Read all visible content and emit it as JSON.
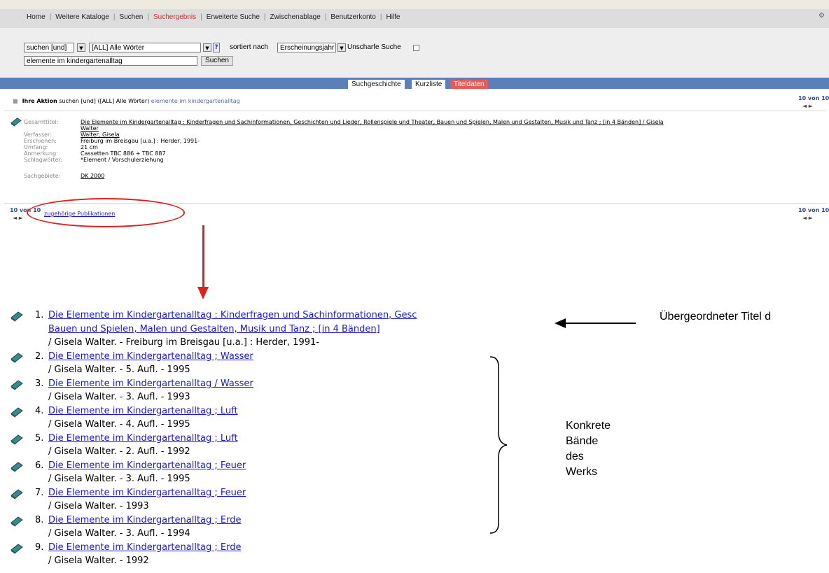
{
  "menu": {
    "items": [
      "Home",
      "Weitere Kataloge",
      "Suchen",
      "Suchergebnis",
      "Erweiterte Suche",
      "Zwischenablage",
      "Benutzerkonto",
      "Hilfe"
    ],
    "active_index": 3
  },
  "search": {
    "operator_value": "suchen [und]",
    "field_value": "[ALL] Alle Wörter",
    "help_symbol": "?",
    "sorted_by_label": "sortiert nach",
    "sort_value": "Erscheinungsjahr",
    "fuzzy_label": "Unscharfe Suche",
    "query_value": "elemente im kindergartenalltag",
    "submit_label": "Suchen"
  },
  "tabs": [
    "Suchgeschichte",
    "Kurzliste",
    "Titeldaten"
  ],
  "action": {
    "label": "Ihre Aktion",
    "text": "suchen [und] ([ALL] Alle Wörter)",
    "query": "elemente im kindergartenalltag"
  },
  "pager": {
    "text": "10 von 10",
    "arrows": "◄  ►"
  },
  "record": {
    "gesamttitel_label": "Gesamttitel:",
    "gesamttitel_line1": "Die Elemente im Kindergartenalltag : Kinderfragen und Sachinformationen, Geschichten und Lieder, Rollenspiele und Theater, Bauen und Spielen, Malen und Gestalten, Musik und Tanz ; [in 4 Bänden] / Gisela",
    "gesamttitel_line2": "Walter",
    "verfasser_label": "Verfasser:",
    "verfasser_value": "Walter, Gisela",
    "erschienen_label": "Erschienen:",
    "erschienen_value": "Freiburg im Breisgau [u.a.] : Herder, 1991-",
    "umfang_label": "Umfang:",
    "umfang_value": "21 cm",
    "anmerkung_label": "Anmerkung:",
    "anmerkung_value": "Cassetten TBC 886 + TBC 887",
    "schlagwoerter_label": "Schlagwörter:",
    "schlagwoerter_value": "*Element / Vorschulerziehung",
    "sachgebiete_label": "Sachgebiete:",
    "sachgebiete_value": "DK 2000"
  },
  "related_link": "zugehörige Publikationen",
  "list": [
    {
      "num": "1.",
      "title": "Die Elemente im Kindergartenalltag : Kinderfragen und Sachinformationen, Gesc",
      "title2": "Bauen und Spielen, Malen und Gestalten, Musik und Tanz ; [in 4 Bänden]",
      "sub": "/ Gisela Walter. - Freiburg im Breisgau [u.a.] : Herder, 1991-"
    },
    {
      "num": "2.",
      "title": "Die Elemente im Kindergartenalltag ; Wasser",
      "sub": "/ Gisela Walter. - 5. Aufl. - 1995"
    },
    {
      "num": "3.",
      "title": "Die Elemente im Kindergartenalltag / Wasser",
      "sub": "/ Gisela Walter. - 3. Aufl. - 1993"
    },
    {
      "num": "4.",
      "title": "Die Elemente im Kindergartenalltag ; Luft",
      "sub": "/ Gisela Walter. - 4. Aufl. - 1995"
    },
    {
      "num": "5.",
      "title": "Die Elemente im Kindergartenalltag ; Luft",
      "sub": "/ Gisela Walter. - 2. Aufl. - 1992"
    },
    {
      "num": "6.",
      "title": "Die Elemente im Kindergartenalltag ; Feuer",
      "sub": "/ Gisela Walter. - 3. Aufl. - 1995"
    },
    {
      "num": "7.",
      "title": "Die Elemente im Kindergartenalltag ; Feuer",
      "sub": "/ Gisela Walter. - 1993"
    },
    {
      "num": "8.",
      "title": "Die Elemente im Kindergartenalltag ; Erde",
      "sub": "/ Gisela Walter. - 3. Aufl. - 1994"
    },
    {
      "num": "9.",
      "title": "Die Elemente im Kindergartenalltag ; Erde",
      "sub": "/ Gisela Walter. - 1992"
    }
  ],
  "annotations": {
    "parent_title": "Übergeordneter Titel d",
    "volumes": [
      "Konkrete",
      "Bände",
      "des",
      "Werks"
    ]
  },
  "colors": {
    "annotation_red": "#e02020",
    "link": "#1a1acc",
    "bluebar": "#5a7fba",
    "active_tab": "#e85a5a"
  }
}
